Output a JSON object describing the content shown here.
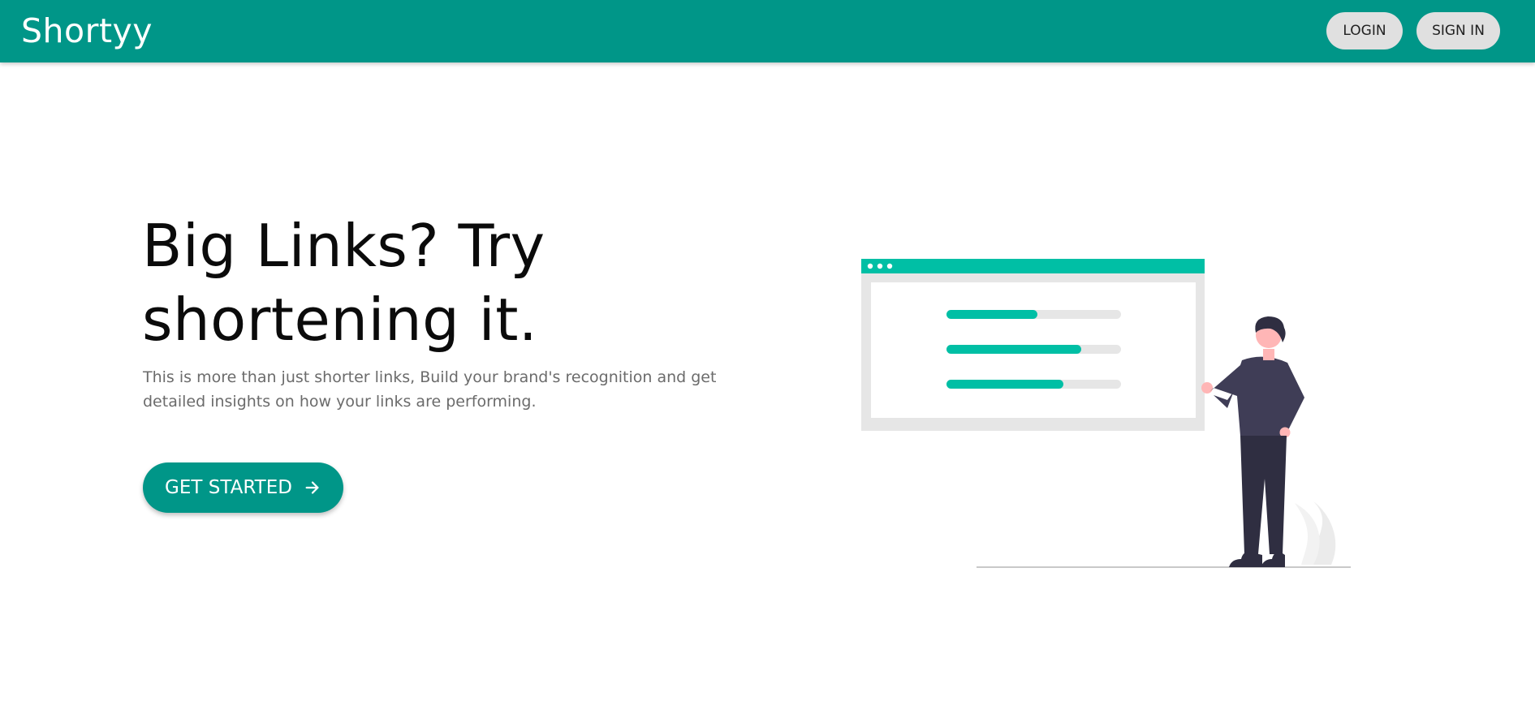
{
  "navbar": {
    "brand": "Shortyy",
    "login_label": "LOGIN",
    "signin_label": "SIGN IN"
  },
  "hero": {
    "title": "Big Links? Try shortening it.",
    "description": "This is more than just shorter links, Build your brand's recognition and get detailed insights on how your links are performing.",
    "cta_label": "GET STARTED",
    "cta_icon": "arrow-right-icon"
  },
  "illustration": {
    "name": "person-presenting-dashboard",
    "progress_fractions": [
      0.52,
      0.77,
      0.67
    ]
  },
  "colors": {
    "primary": "#009688",
    "accent": "#00bfa5",
    "nav_button_bg": "#e0e0e0",
    "text_dark": "#0b0b0b",
    "text_muted": "#6b6b6b"
  }
}
